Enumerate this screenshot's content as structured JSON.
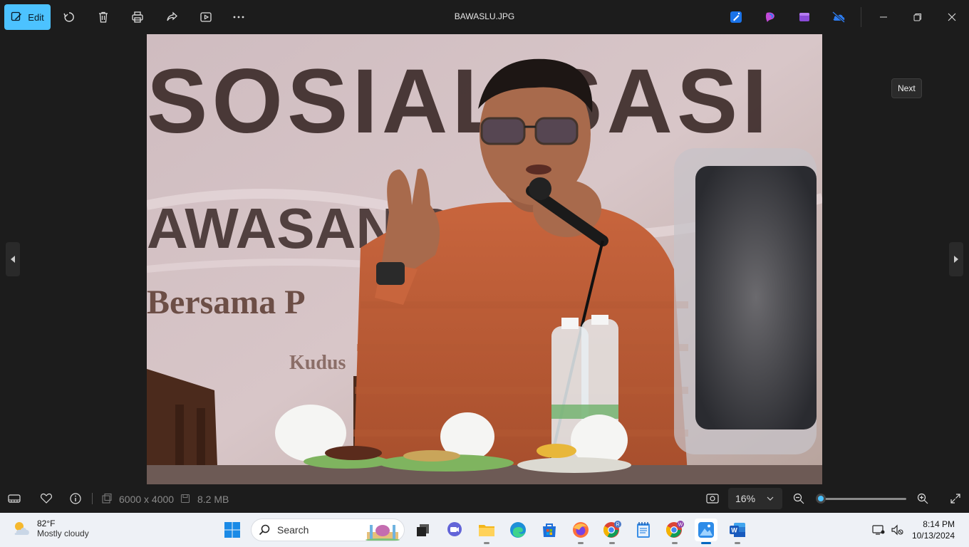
{
  "window": {
    "title": "BAWASLU.JPG",
    "edit_label": "Edit",
    "tooltip": "Next"
  },
  "photo": {
    "banner_line1": "SOSIALISASI",
    "banner_line2": "AWASAN PA",
    "banner_line3": "Bersama P",
    "banner_line4": "Kudus"
  },
  "status": {
    "dimensions": "6000 x 4000",
    "filesize": "8.2 MB",
    "zoom": "16%",
    "zoom_fraction": 0.02
  },
  "taskbar": {
    "weather_temp": "82°F",
    "weather_desc": "Mostly cloudy",
    "search_label": "Search",
    "time": "8:14 PM",
    "date": "10/13/2024"
  },
  "colors": {
    "accent": "#4cc2ff",
    "app_bg": "#1c1c1c",
    "taskbar_bg": "#eef1f6"
  }
}
